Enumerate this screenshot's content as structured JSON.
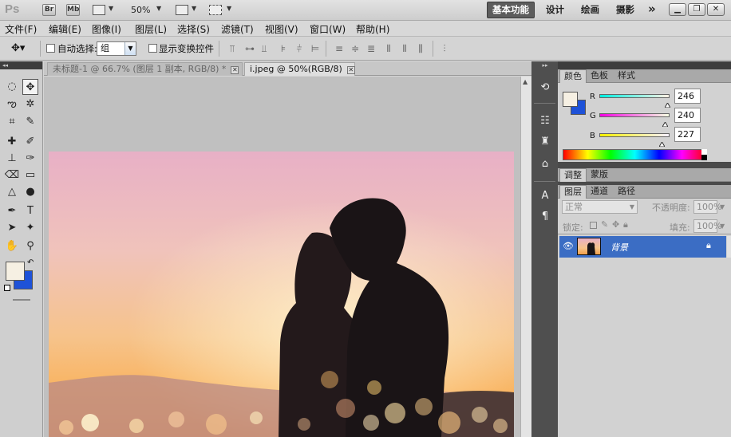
{
  "appbar": {
    "logo": "Ps",
    "bridge": "Br",
    "minibridge": "Mb",
    "zoom": "50%",
    "workspaces": [
      "基本功能",
      "设计",
      "绘画",
      "摄影"
    ],
    "more": "»"
  },
  "menu": [
    "文件(F)",
    "编辑(E)",
    "图像(I)",
    "图层(L)",
    "选择(S)",
    "滤镜(T)",
    "视图(V)",
    "窗口(W)",
    "帮助(H)"
  ],
  "options": {
    "auto_select_label": "自动选择:",
    "auto_select_value": "组",
    "show_transform_label": "显示变换控件"
  },
  "tabs": [
    {
      "title": "未标题-1 @ 66.7% (图层 1 副本, RGB/8) *"
    },
    {
      "title": "i.jpeg @ 50%(RGB/8)"
    }
  ],
  "color_panel": {
    "tabs": [
      "颜色",
      "色板",
      "样式"
    ],
    "channels": [
      {
        "label": "R",
        "value": "246"
      },
      {
        "label": "G",
        "value": "240"
      },
      {
        "label": "B",
        "value": "227"
      }
    ],
    "foreground": "#F6F0E3",
    "background": "#1E52D8"
  },
  "adjust_panel": {
    "tabs": [
      "调整",
      "蒙版"
    ]
  },
  "layers_panel": {
    "tabs": [
      "图层",
      "通道",
      "路径"
    ],
    "blend_mode": "正常",
    "opacity_label": "不透明度:",
    "opacity_value": "100%",
    "lock_label": "锁定:",
    "fill_label": "填充:",
    "fill_value": "100%",
    "layers": [
      {
        "name": "背景",
        "selected": true
      }
    ]
  },
  "colors": {
    "selection": "#3B6DC4",
    "dark_ui": "#4F4F4F"
  }
}
